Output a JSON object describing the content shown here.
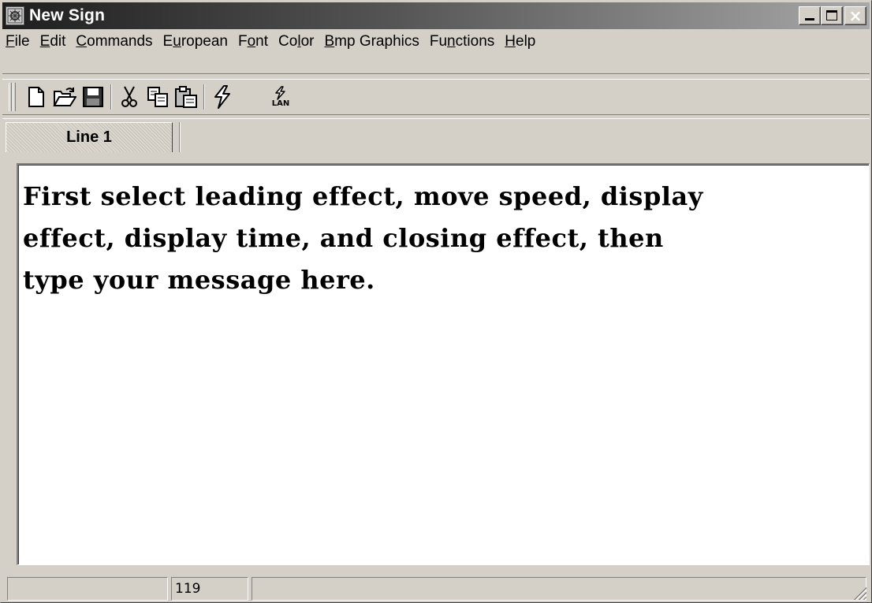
{
  "window": {
    "title": "New Sign",
    "icon": "app-icon"
  },
  "title_buttons": {
    "minimize": "minimize-icon",
    "maximize": "maximize-icon",
    "close": "close-icon"
  },
  "menu": {
    "items": [
      {
        "label_pre": "",
        "mnemonic": "F",
        "label_post": "ile"
      },
      {
        "label_pre": "",
        "mnemonic": "E",
        "label_post": "dit"
      },
      {
        "label_pre": "",
        "mnemonic": "C",
        "label_post": "ommands"
      },
      {
        "label_pre": "E",
        "mnemonic": "u",
        "label_post": "ropean"
      },
      {
        "label_pre": "F",
        "mnemonic": "o",
        "label_post": "nt"
      },
      {
        "label_pre": "Co",
        "mnemonic": "l",
        "label_post": "or"
      },
      {
        "label_pre": "",
        "mnemonic": "B",
        "label_post": "mp Graphics"
      },
      {
        "label_pre": "Fu",
        "mnemonic": "n",
        "label_post": "ctions"
      },
      {
        "label_pre": "",
        "mnemonic": "H",
        "label_post": "elp"
      }
    ]
  },
  "toolbar": {
    "buttons": [
      "new-file-icon",
      "open-folder-icon",
      "save-disk-icon",
      "cut-scissors-icon",
      "copy-icon",
      "paste-icon",
      "send-lightning-icon",
      "send-lan-icon"
    ],
    "lan_label": "LAN"
  },
  "tabs": [
    {
      "label": "Line 1",
      "active": true
    }
  ],
  "editor": {
    "text": "First select leading effect, move speed, display\neffect, display time, and closing effect, then\ntype your message here."
  },
  "statusbar": {
    "panel1": "",
    "panel2": "119",
    "panel3": ""
  }
}
